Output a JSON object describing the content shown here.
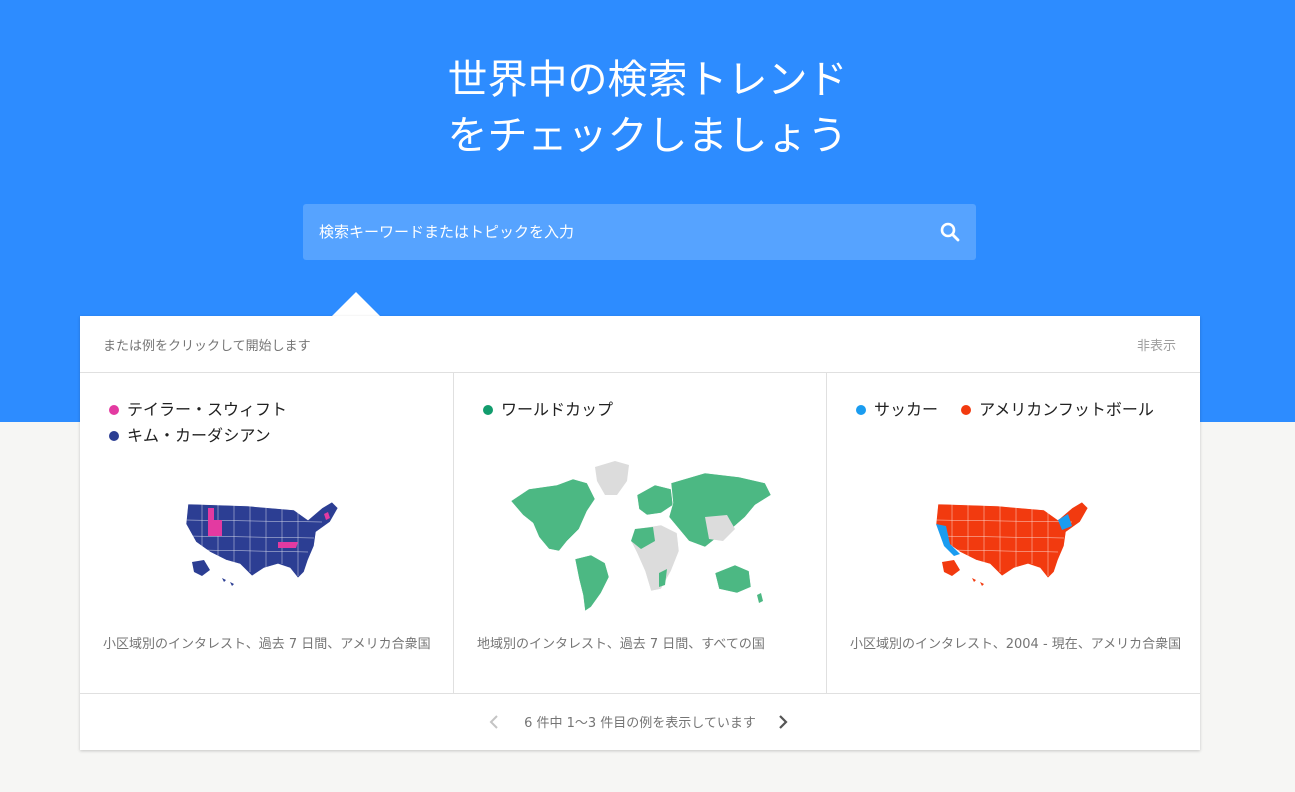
{
  "hero": {
    "title_line1": "世界中の検索トレンド",
    "title_line2": "をチェックしましょう",
    "bg_color": "#2d8cff"
  },
  "search": {
    "placeholder": "検索キーワードまたはトピックを入力",
    "icon": "search-icon"
  },
  "examples_panel": {
    "hint": "または例をクリックして開始します",
    "hide_label": "非表示",
    "items": [
      {
        "legend": [
          {
            "label": "テイラー・スウィフト",
            "color": "#e33aa1"
          },
          {
            "label": "キム・カーダシアン",
            "color": "#2c3e93"
          }
        ],
        "map": "us-states-map",
        "caption": "小区域別のインタレスト、過去 7 日間、アメリカ合衆国"
      },
      {
        "legend": [
          {
            "label": "ワールドカップ",
            "color": "#129c6d"
          }
        ],
        "map": "world-map",
        "caption": "地域別のインタレスト、過去 7 日間、すべての国"
      },
      {
        "legend": [
          {
            "label": "サッカー",
            "color": "#1a9cf0"
          },
          {
            "label": "アメリカンフットボール",
            "color": "#f23a0f"
          }
        ],
        "map": "us-states-map",
        "caption": "小区域別のインタレスト、2004 - 現在、アメリカ合衆国"
      }
    ],
    "pager_text": "6 件中 1～3 件目の例を表示しています",
    "prev_icon": "chevron-left-icon",
    "next_icon": "chevron-right-icon"
  }
}
